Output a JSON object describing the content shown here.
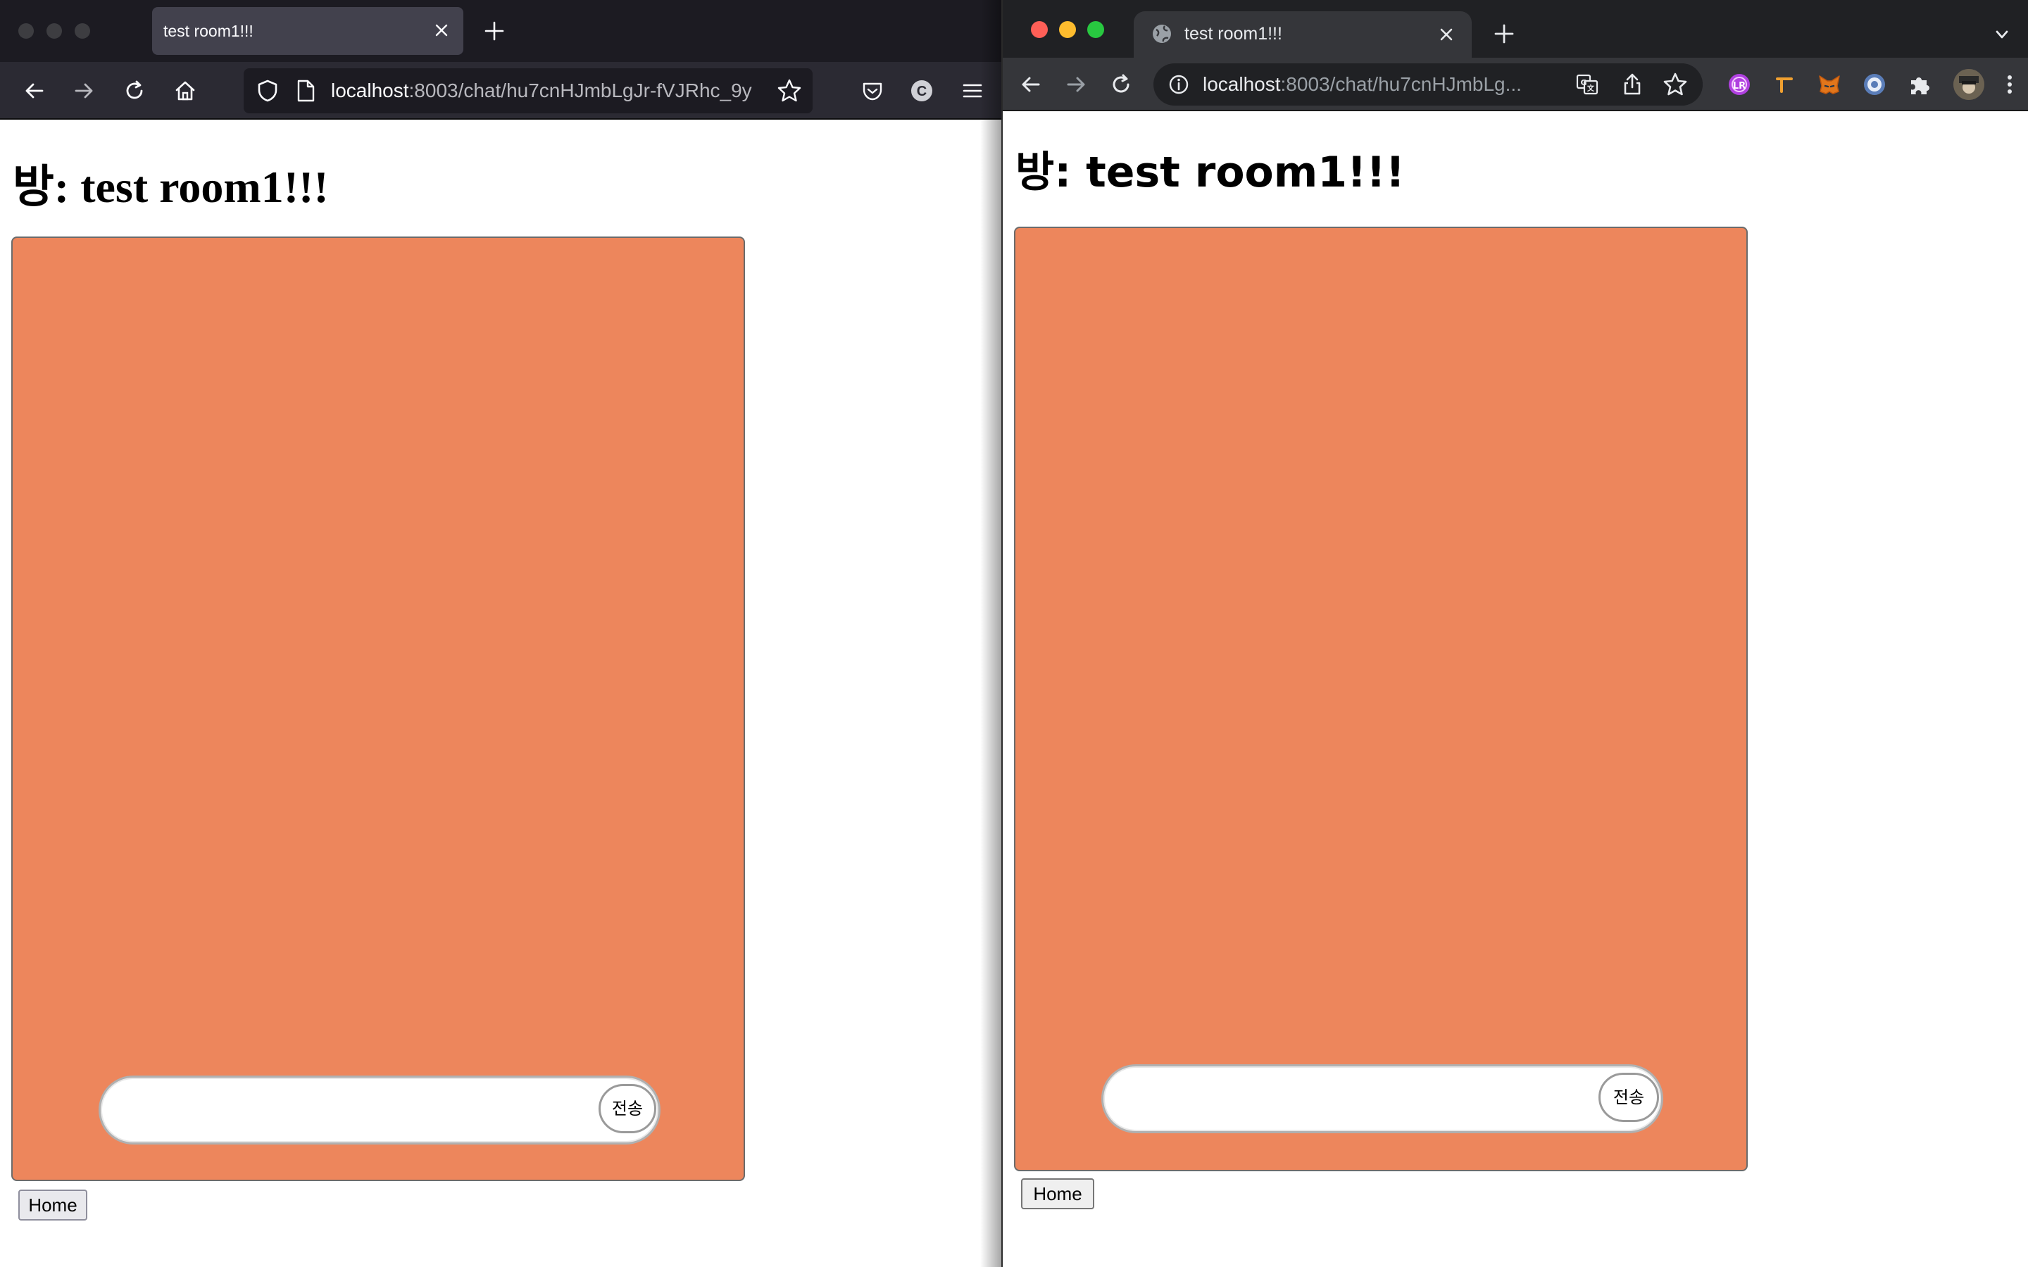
{
  "left_window": {
    "tab_title": "test room1!!!",
    "url_host": "localhost",
    "url_path": ":8003/chat/hu7cnHJmbLgJr-fVJRhc_9y",
    "heading": "방: test room1!!!",
    "chat_input_value": "",
    "send_label": "전송",
    "home_label": "Home"
  },
  "right_window": {
    "tab_title": "test room1!!!",
    "url_host": "localhost",
    "url_path": ":8003/chat/hu7cnHJmbLg...",
    "heading": "방: test room1!!!",
    "chat_input_value": "",
    "send_label": "전송",
    "home_label": "Home"
  },
  "colors": {
    "chat_box": "#ed865c",
    "firefox_dark": "#1c1b22",
    "firefox_toolbar": "#2b2a33",
    "chrome_dark": "#202124",
    "chrome_toolbar": "#35363a",
    "mac_close": "#ff5f57",
    "mac_minimize": "#febc2e",
    "mac_zoom": "#28c840"
  },
  "icons": {
    "left_toolbar": [
      "back-icon",
      "forward-icon",
      "reload-icon",
      "home-icon",
      "shield-icon",
      "page-icon",
      "star-icon",
      "pocket-icon",
      "account-icon",
      "menu-icon"
    ],
    "right_toolbar": [
      "back-icon",
      "forward-icon",
      "reload-icon",
      "info-icon",
      "translate-icon",
      "share-icon",
      "star-icon",
      "extension-icons",
      "puzzle-icon",
      "profile-avatar",
      "kebab-menu-icon"
    ]
  }
}
